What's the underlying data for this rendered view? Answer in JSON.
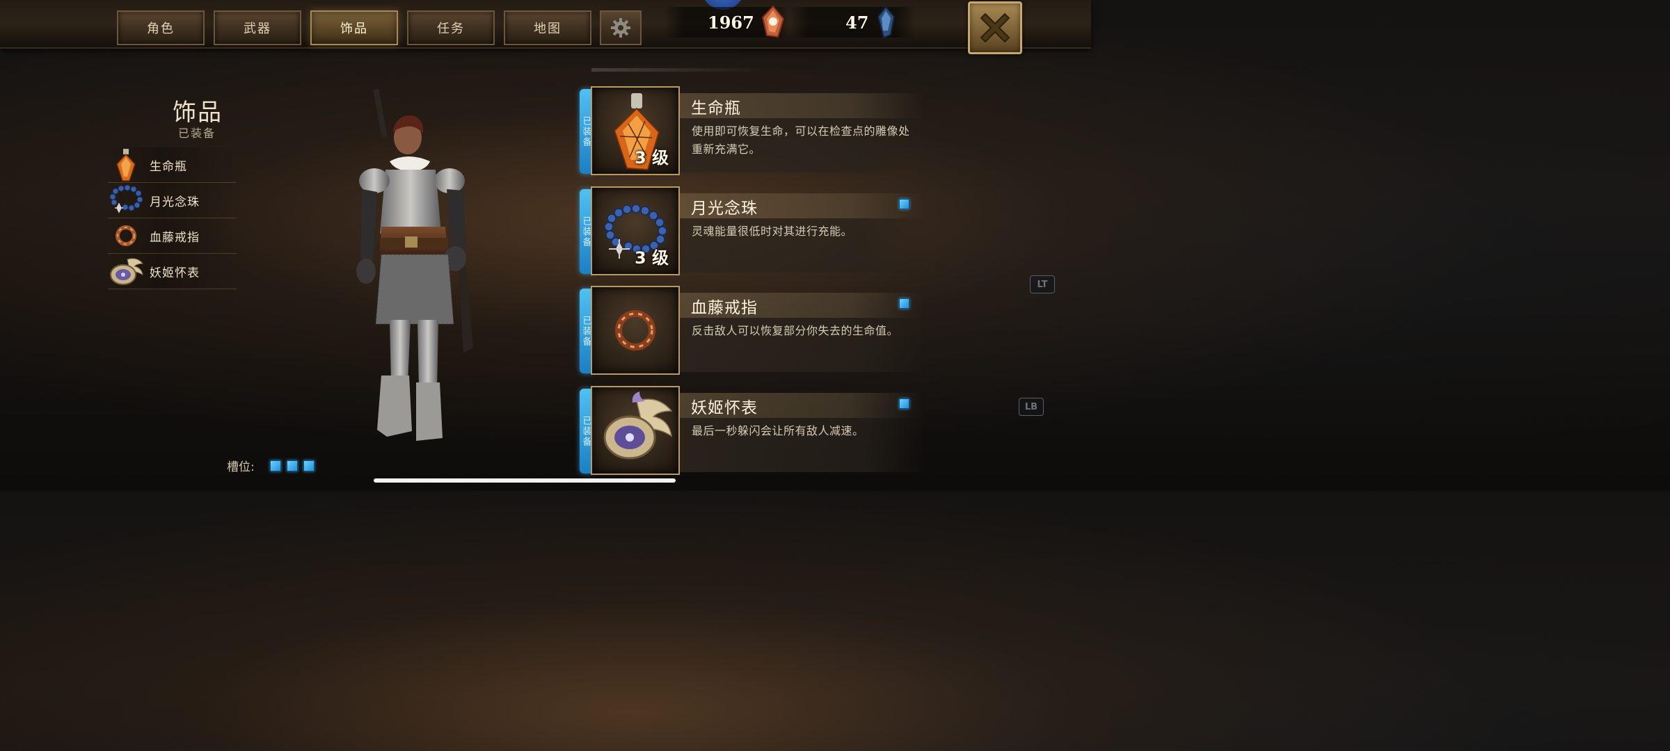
{
  "tabs": [
    {
      "label": "角色",
      "active": false
    },
    {
      "label": "武器",
      "active": false
    },
    {
      "label": "饰品",
      "active": true
    },
    {
      "label": "任务",
      "active": false
    },
    {
      "label": "地图",
      "active": false
    }
  ],
  "settings_icon": "gear-icon",
  "currency": {
    "souls": "1967",
    "souls_icon": "orange-crystal-icon",
    "gems": "47",
    "gems_icon": "blue-crystal-icon"
  },
  "close_icon": "close-icon",
  "panel": {
    "title": "饰品",
    "subtitle": "已装备",
    "equipped": [
      {
        "label": "生命瓶",
        "icon": "potion-icon"
      },
      {
        "label": "月光念珠",
        "icon": "beads-icon"
      },
      {
        "label": "血藤戒指",
        "icon": "ring-icon"
      },
      {
        "label": "妖姬怀表",
        "icon": "pocket-watch-icon"
      }
    ],
    "slots_label": "槽位:",
    "slot_count": 3
  },
  "cards": [
    {
      "badge": "已装备",
      "name": "生命瓶",
      "level": "3 级",
      "desc": "使用即可恢复生命，可以在检查点的雕像处重新充满它。",
      "marked": false
    },
    {
      "badge": "已装备",
      "name": "月光念珠",
      "level": "3 级",
      "desc": "灵魂能量很低时对其进行充能。",
      "marked": true
    },
    {
      "badge": "已装备",
      "name": "血藤戒指",
      "level": "",
      "desc": "反击敌人可以恢复部分你失去的生命值。",
      "marked": true
    },
    {
      "badge": "已装备",
      "name": "妖姬怀表",
      "level": "",
      "desc": "最后一秒躲闪会让所有敌人减速。",
      "marked": true
    }
  ],
  "controller": {
    "lt": "LT",
    "lb": "LB"
  },
  "colors": {
    "accent_blue": "#2a9be0",
    "gold": "#b99a60",
    "bg": "#141312"
  }
}
